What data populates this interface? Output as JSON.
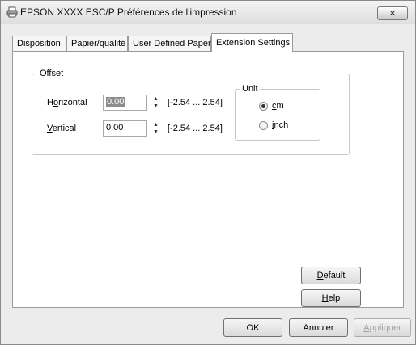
{
  "window": {
    "title": "EPSON XXXX ESC/P Préférences de l'impression",
    "close_label": "✕"
  },
  "tabs": [
    {
      "label": "Disposition",
      "active": false
    },
    {
      "label": "Papier/qualité",
      "active": false
    },
    {
      "label": "User Defined Paper",
      "active": false
    },
    {
      "label": "Extension Settings",
      "active": true
    }
  ],
  "offset": {
    "group_label": "Offset",
    "horizontal": {
      "label_pre": "H",
      "label_mnemonic": "o",
      "label_post": "rizontal",
      "value": "0.00",
      "range": "[-2.54 ... 2.54]"
    },
    "vertical": {
      "label_pre": "",
      "label_mnemonic": "V",
      "label_post": "ertical",
      "value": "0.00",
      "range": "[-2.54 ... 2.54]"
    }
  },
  "unit": {
    "group_label": "Unit",
    "options": [
      {
        "mnemonic": "c",
        "rest": "m",
        "checked": true
      },
      {
        "mnemonic": "i",
        "rest": "nch",
        "checked": false
      }
    ]
  },
  "buttons": {
    "default": {
      "mnemonic": "D",
      "rest": "efault"
    },
    "help": {
      "mnemonic": "H",
      "rest": "elp"
    },
    "ok": "OK",
    "annuler": "Annuler",
    "appliquer": {
      "mnemonic": "A",
      "rest": "ppliquer"
    }
  }
}
